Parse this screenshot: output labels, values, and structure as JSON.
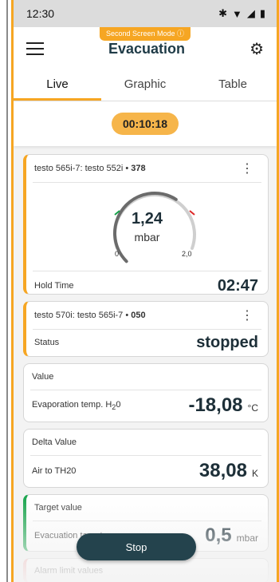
{
  "statusbar": {
    "time": "12:30",
    "icons": [
      "bluetooth-icon",
      "wifi-icon",
      "signal-icon",
      "battery-icon"
    ]
  },
  "appbar": {
    "mode_badge": "Second Screen Mode",
    "title": "Evacuation"
  },
  "tabs": [
    {
      "label": "Live"
    },
    {
      "label": "Graphic"
    },
    {
      "label": "Table"
    }
  ],
  "timer": "00:10:18",
  "card1": {
    "title_prefix": "testo 565i-7: testo 552i",
    "title_id": "378",
    "value": "1,24",
    "unit": "mbar",
    "min": "0",
    "max": "2,0",
    "gauge_level": 0.62,
    "hold_label": "Hold Time",
    "hold_value": "02:47"
  },
  "card2": {
    "title_prefix": "testo 570i: testo 565i-7",
    "title_id": "050",
    "status_label": "Status",
    "status_value": "stopped"
  },
  "card3": {
    "title": "Value",
    "label": "Evaporation temp. H",
    "label_sub": "2",
    "label_tail": "0",
    "value": "-18,08",
    "unit": "°C"
  },
  "card4": {
    "title": "Delta Value",
    "label": "Air to TH20",
    "value": "38,08",
    "unit": "K"
  },
  "card5": {
    "title": "Target value",
    "label": "Evacuation target",
    "value": "0,5",
    "unit": "mbar"
  },
  "card6": {
    "title": "Alarm limit values"
  },
  "stop_label": "Stop",
  "colors": {
    "accent": "#f6a623",
    "dark": "#24434d",
    "green": "#16a34a"
  }
}
